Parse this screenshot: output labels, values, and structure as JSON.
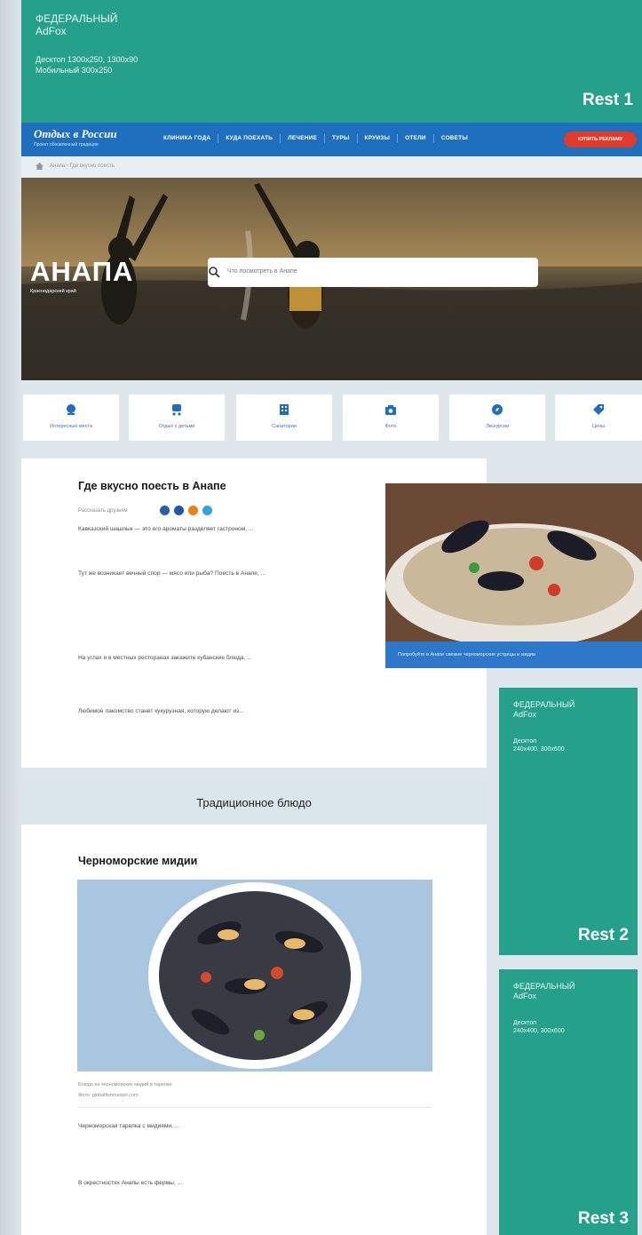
{
  "top_ad": {
    "line1": "ФЕДЕРАЛЬНЫЙ",
    "line2": "AdFox",
    "line3": "Десктоп 1300х250, 1300х90",
    "line4": "Мобильный 300х250",
    "rest_label": "Rest 1"
  },
  "nav": {
    "logo_title": "Отдых в России",
    "logo_subtitle": "Проект обновленный традиции",
    "items": [
      "КЛИНИКА ГОДА",
      "КУДА ПОЕХАТЬ",
      "ЛЕЧЕНИЕ",
      "ТУРЫ",
      "КРУИЗЫ",
      "ОТЕЛИ",
      "СОВЕТЫ"
    ],
    "cta": "КУПИТЬ РЕКЛАМУ"
  },
  "breadcrumbs": "Анапа  ›  Где вкусно поесть",
  "hero": {
    "title": "АНАПА",
    "subtitle": "Краснодарский край",
    "search_placeholder": "Что посмотреть в Анапе"
  },
  "categories": [
    {
      "label": "Интересные места",
      "icon": "landmark-icon"
    },
    {
      "label": "Отдых с детьми",
      "icon": "stroller-icon"
    },
    {
      "label": "Санатории",
      "icon": "building-icon"
    },
    {
      "label": "Фото",
      "icon": "camera-icon"
    },
    {
      "label": "Экскурсии",
      "icon": "compass-icon"
    },
    {
      "label": "Цены",
      "icon": "tag-icon"
    }
  ],
  "article": {
    "title": "Где вкусно поесть в Анапе",
    "share_label": "Рассказать друзьям",
    "paragraphs": [
      "Кавказский шашлык — это его ароматы разделяет гастроном, ...",
      "Тут же возникает вечный спор — мясо или рыба? Поесть в Анапе, ...",
      "На углах и в местных ресторанах закажите кубанские блюда, ...",
      "Любимое лакомство станет кукурузная, которую делают из..."
    ],
    "photo_caption": "Попробуйте в Анапе свежие черноморские устрицы и мидии"
  },
  "section_band": "Традиционное блюдо",
  "dish": {
    "title": "Черноморские мидии",
    "caption1": "Блюдо из черноморских мидий в тарелке",
    "caption2": "Фото: globalfishmarket.com",
    "paragraphs": [
      "Черноморская тарелка с мидиями, ...",
      "В окрестностях Анапы есть фермы, ..."
    ]
  },
  "side_ads": [
    {
      "line1": "ФЕДЕРАЛЬНЫЙ",
      "line2": "AdFox",
      "line3": "Десктоп",
      "line4": "240х400, 300х600",
      "rest_label": "Rest 2"
    },
    {
      "line1": "ФЕДЕРАЛЬНЫЙ",
      "line2": "AdFox",
      "line3": "Десктоп",
      "line4": "240х400, 300х600",
      "rest_label": "Rest 3"
    }
  ],
  "colors": {
    "ad_green": "#25a08a",
    "nav_blue": "#1f6fbf",
    "cta_red": "#e23a2b",
    "page_bg": "#dde7ec"
  }
}
